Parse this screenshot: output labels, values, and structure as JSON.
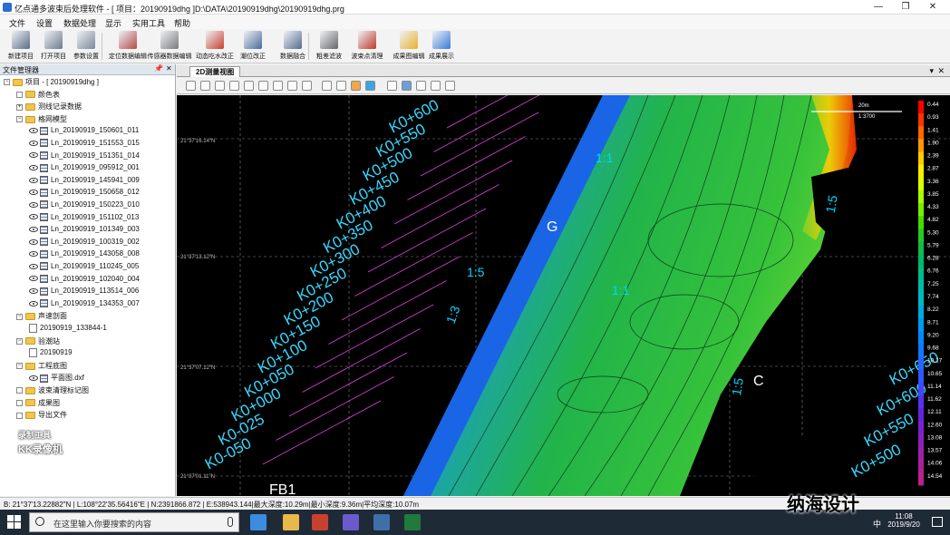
{
  "window": {
    "title": "亿点通多波束后处理软件 - [ 项目：20190919dhg ]D:\\DATA\\20190919dhg\\20190919dhg.prg",
    "controls": [
      "—",
      "❐",
      "✕"
    ]
  },
  "menu": [
    "文件",
    "设置",
    "数据处理",
    "显示",
    "实用工具",
    "帮助"
  ],
  "toolbar": [
    {
      "label": "新建项目",
      "icon": "new-project-icon",
      "color": "#5a6c86"
    },
    {
      "label": "打开项目",
      "icon": "open-project-icon",
      "color": "#6b7a90"
    },
    {
      "label": "参数设置",
      "icon": "settings-icon",
      "color": "#7a8899"
    },
    {
      "label": "定位数据编辑",
      "icon": "position-edit-icon",
      "color": "#b54a4a"
    },
    {
      "label": "传感器数据编辑",
      "icon": "sensor-edit-icon",
      "color": "#7a7a7a"
    },
    {
      "label": "动态吃水改正",
      "icon": "draft-correction-icon",
      "color": "#c8402e"
    },
    {
      "label": "潮位改正",
      "icon": "tide-correction-icon",
      "color": "#4a6a9a"
    },
    {
      "label": "数据融合",
      "icon": "data-merge-icon",
      "color": "#556b8e"
    },
    {
      "label": "粗差滤波",
      "icon": "filter-icon",
      "color": "#666666"
    },
    {
      "label": "波束点清理",
      "icon": "beam-clean-icon",
      "color": "#c0392b"
    },
    {
      "label": "成果图编辑",
      "icon": "result-map-icon",
      "color": "#e7b12b"
    },
    {
      "label": "成果展示",
      "icon": "result-display-icon",
      "color": "#3a7bd5"
    }
  ],
  "file_manager": {
    "title": "文件管理器",
    "pin": "📌",
    "close": "✕"
  },
  "tree": [
    {
      "label": "项目 - [ 20190919dhg ]",
      "level": 0,
      "type": "folder",
      "exp": "−"
    },
    {
      "label": "颜色表",
      "level": 1,
      "type": "folder",
      "exp": ""
    },
    {
      "label": "测线记录数据",
      "level": 1,
      "type": "folder",
      "exp": "+"
    },
    {
      "label": "格网模型",
      "level": 1,
      "type": "folder",
      "exp": "−"
    },
    {
      "label": "Ln_20190919_150601_011",
      "level": 2,
      "type": "grid"
    },
    {
      "label": "Ln_20190919_151553_015",
      "level": 2,
      "type": "grid"
    },
    {
      "label": "Ln_20190919_151351_014",
      "level": 2,
      "type": "grid"
    },
    {
      "label": "Ln_20190919_095912_001",
      "level": 2,
      "type": "grid"
    },
    {
      "label": "Ln_20190919_145941_009",
      "level": 2,
      "type": "grid"
    },
    {
      "label": "Ln_20190919_150658_012",
      "level": 2,
      "type": "grid"
    },
    {
      "label": "Ln_20190919_150223_010",
      "level": 2,
      "type": "grid"
    },
    {
      "label": "Ln_20190919_151102_013",
      "level": 2,
      "type": "grid"
    },
    {
      "label": "Ln_20190919_101349_003",
      "level": 2,
      "type": "grid"
    },
    {
      "label": "Ln_20190919_100319_002",
      "level": 2,
      "type": "grid"
    },
    {
      "label": "Ln_20190919_143058_008",
      "level": 2,
      "type": "grid"
    },
    {
      "label": "Ln_20190919_110245_005",
      "level": 2,
      "type": "grid"
    },
    {
      "label": "Ln_20190919_102040_004",
      "level": 2,
      "type": "grid"
    },
    {
      "label": "Ln_20190919_113514_006",
      "level": 2,
      "type": "grid"
    },
    {
      "label": "Ln_20190919_134353_007",
      "level": 2,
      "type": "grid"
    },
    {
      "label": "声速剖面",
      "level": 1,
      "type": "folder",
      "exp": "−"
    },
    {
      "label": "20190919_133844-1",
      "level": 2,
      "type": "doc"
    },
    {
      "label": "验潮站",
      "level": 1,
      "type": "folder",
      "exp": "−"
    },
    {
      "label": "20190919",
      "level": 2,
      "type": "doc"
    },
    {
      "label": "工程底图",
      "level": 1,
      "type": "folder",
      "exp": "−"
    },
    {
      "label": "平面图.dxf",
      "level": 2,
      "type": "grid"
    },
    {
      "label": "波束清理标记图",
      "level": 1,
      "type": "folder",
      "exp": ""
    },
    {
      "label": "成果图",
      "level": 1,
      "type": "folder",
      "exp": ""
    },
    {
      "label": "导出文件",
      "level": 1,
      "type": "folder",
      "exp": ""
    }
  ],
  "watermark": {
    "line1": "录制工具",
    "line2": "KK录像机"
  },
  "view": {
    "tab": "2D测量视图",
    "map": {
      "chainage_left": [
        "K0+600",
        "K0+550",
        "K0+500",
        "K0+450",
        "K0+400",
        "K0+350",
        "K0+300",
        "K0+250",
        "K0+200",
        "K0+150",
        "K0+100",
        "K0+050",
        "K0+000",
        "K0-025",
        "K0-050"
      ],
      "chainage_right": [
        "K0+650",
        "K0+600",
        "K0+550",
        "K0+500"
      ],
      "lat_labels": [
        "21°37'16.14\"N",
        "21°37'13.12\"N",
        "21°37'07.12\"N",
        "21°37'01.11\"N"
      ],
      "annotations": [
        "G",
        "C",
        "FB1",
        "1:5",
        "1:5",
        "1:1",
        "1:1",
        "1:3",
        "1:5"
      ],
      "scale": "1:3700",
      "scale_unit": "20m"
    },
    "legend": {
      "values": [
        "0.44",
        "0.93",
        "1.41",
        "1.90",
        "2.39",
        "2.87",
        "3.36",
        "3.85",
        "4.33",
        "4.82",
        "5.30",
        "5.79",
        "6.28",
        "6.76",
        "7.25",
        "7.74",
        "8.22",
        "8.71",
        "9.20",
        "9.68",
        "10.17",
        "10.65",
        "11.14",
        "11.62",
        "12.11",
        "12.60",
        "13.08",
        "13.57",
        "14.06",
        "14.54"
      ],
      "colors": [
        "#ff0000",
        "#ff3300",
        "#ff6600",
        "#ff9900",
        "#ffcc00",
        "#ffee00",
        "#ddff00",
        "#aaff00",
        "#77ee00",
        "#44dd00",
        "#22cc22",
        "#11bb44",
        "#00bb66",
        "#00bb88",
        "#00bbaa",
        "#00b8c4",
        "#00aadd",
        "#0099ee",
        "#0088ff",
        "#1177ff",
        "#2266ff",
        "#3355ff",
        "#4444ff",
        "#5533ee",
        "#6622dd",
        "#7722cc",
        "#8822bb",
        "#9922aa",
        "#aa2299",
        "#bb2288"
      ]
    }
  },
  "status": "B: 21°37'13.22882\"N | L:108°22'35.56416\"E | N:2391866.872 | E:538943.144|最大深度:10.29m|最小深度:9.36m|平均深度:10.07m",
  "taskbar": {
    "search_placeholder": "在这里输入你要搜索的内容",
    "time": "11:08",
    "date": "2019/9/20",
    "ime": "中",
    "overlay_text": "纳海设计"
  }
}
